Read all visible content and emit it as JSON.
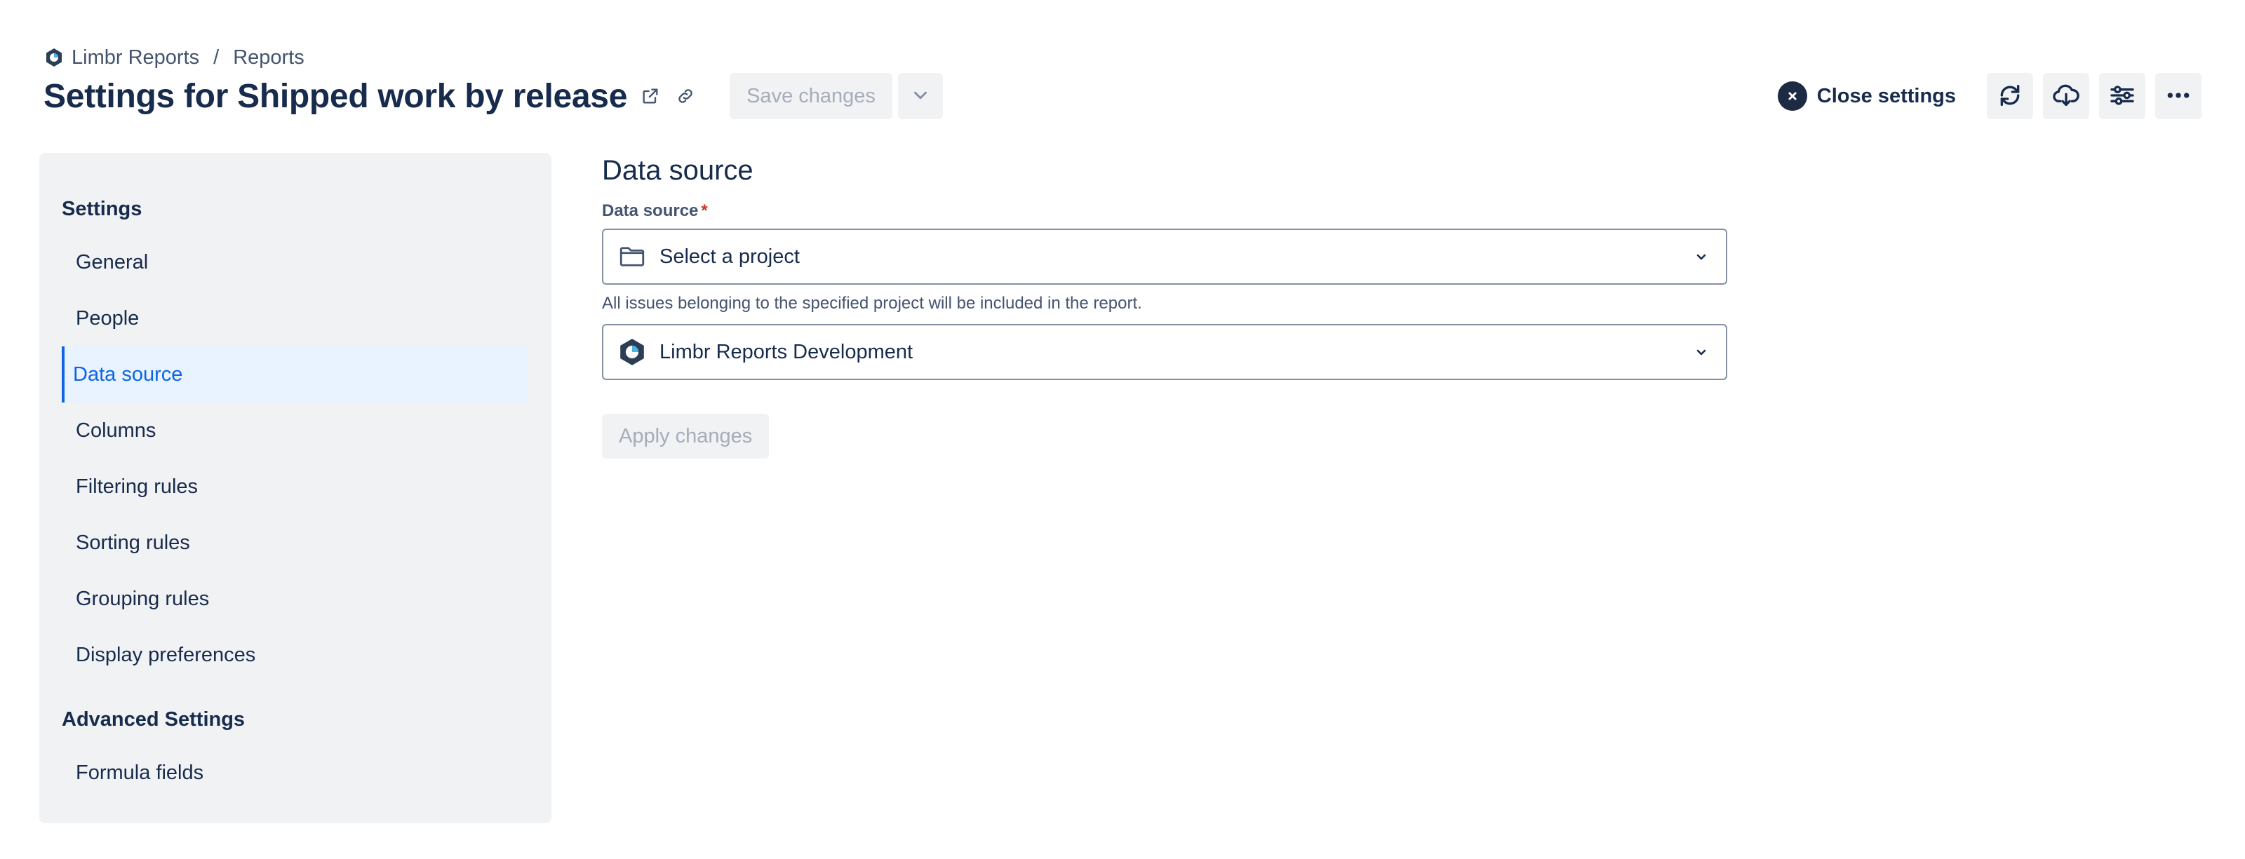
{
  "breadcrumb": {
    "app_name": "Limbr Reports",
    "separator": "/",
    "current": "Reports",
    "logo_icon": "limbr-logo-icon"
  },
  "header": {
    "title": "Settings for Shipped work by release",
    "open_icon": "external-link-icon",
    "link_icon": "link-icon",
    "save_label": "Save changes",
    "dropdown_icon": "chevron-down-icon"
  },
  "header_right": {
    "close_label": "Close settings",
    "close_icon": "close-circle-icon",
    "buttons": [
      "refresh-icon",
      "cloud-download-icon",
      "sliders-icon",
      "more-icon"
    ]
  },
  "sidebar": {
    "settings_heading": "Settings",
    "items": [
      {
        "label": "General",
        "active": false
      },
      {
        "label": "People",
        "active": false
      },
      {
        "label": "Data source",
        "active": true
      },
      {
        "label": "Columns",
        "active": false
      },
      {
        "label": "Filtering rules",
        "active": false
      },
      {
        "label": "Sorting rules",
        "active": false
      },
      {
        "label": "Grouping rules",
        "active": false
      },
      {
        "label": "Display preferences",
        "active": false
      }
    ],
    "advanced_heading": "Advanced Settings",
    "advanced_items": [
      {
        "label": "Formula fields",
        "active": false
      }
    ]
  },
  "main": {
    "title": "Data source",
    "field_label": "Data source",
    "required_marker": "*",
    "source_select": {
      "value": "Select a project",
      "icon": "folder-icon"
    },
    "helper_text": "All issues belonging to the specified project will be included in the report.",
    "project_select": {
      "value": "Limbr Reports Development",
      "icon": "project-avatar-icon"
    },
    "apply_label": "Apply changes"
  },
  "colors": {
    "accent": "#0c66e4",
    "active_bg": "#e9f2ff",
    "sidebar_bg": "#f1f2f4",
    "text": "#172b4d",
    "required": "#c9372c"
  }
}
